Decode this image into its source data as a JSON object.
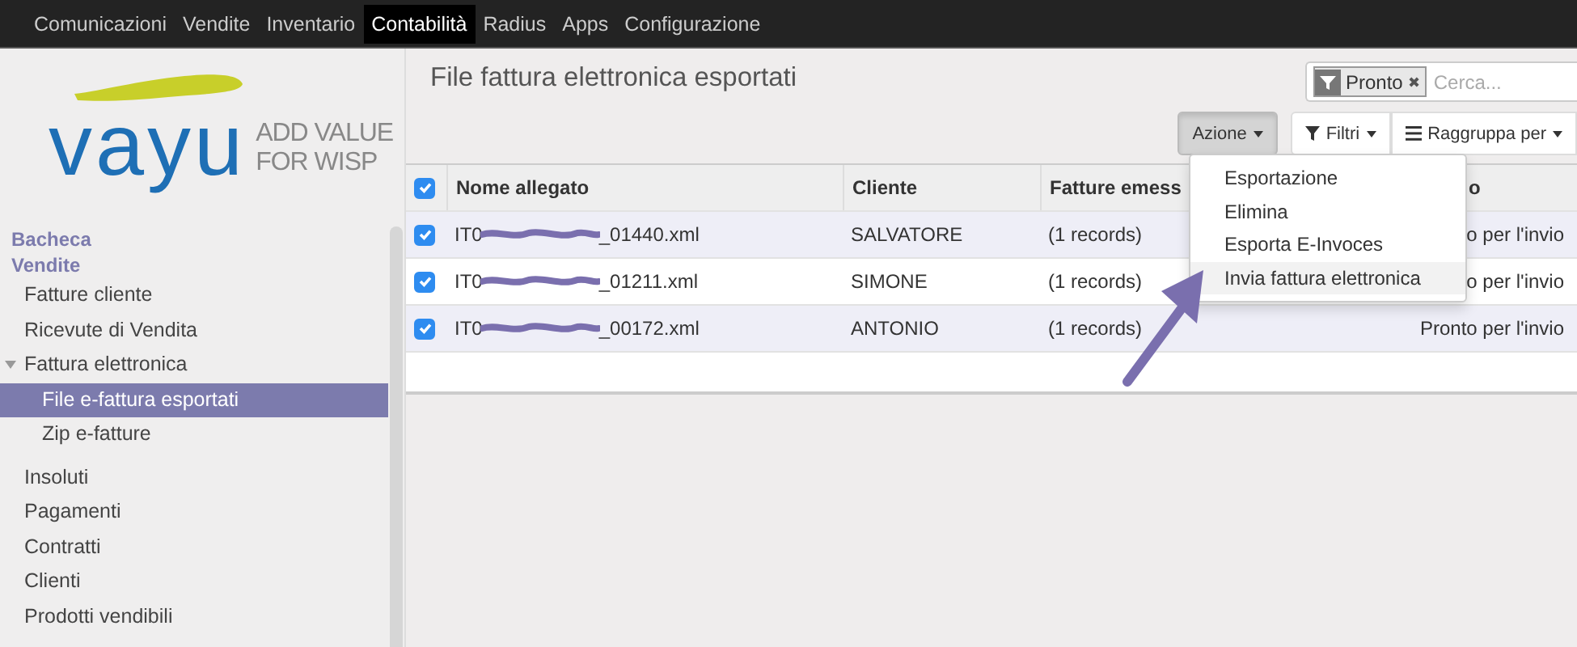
{
  "top_menu": [
    {
      "label": "Comunicazioni",
      "selected": false
    },
    {
      "label": "Vendite",
      "selected": false
    },
    {
      "label": "Inventario",
      "selected": false
    },
    {
      "label": "Contabilità",
      "selected": true
    },
    {
      "label": "Radius",
      "selected": false
    },
    {
      "label": "Apps",
      "selected": false
    },
    {
      "label": "Configurazione",
      "selected": false
    }
  ],
  "logo": {
    "wordmark": "vayu",
    "tagline_1": "ADD VALUE",
    "tagline_2": "FOR WISP"
  },
  "sidebar": {
    "items": [
      {
        "kind": "heading",
        "label": "Bacheca"
      },
      {
        "kind": "heading",
        "label": "Vendite"
      },
      {
        "kind": "item",
        "label": "Fatture cliente",
        "selected": false
      },
      {
        "kind": "item",
        "label": "Ricevute di Vendita",
        "selected": false
      },
      {
        "kind": "group",
        "label": "Fattura elettronica",
        "expanded": true,
        "children": [
          {
            "label": "File e-fattura esportati",
            "selected": true
          },
          {
            "label": "Zip e-fatture",
            "selected": false
          }
        ]
      },
      {
        "kind": "item",
        "label": "Insoluti",
        "selected": false
      },
      {
        "kind": "item",
        "label": "Pagamenti",
        "selected": false
      },
      {
        "kind": "item",
        "label": "Contratti",
        "selected": false
      },
      {
        "kind": "item",
        "label": "Clienti",
        "selected": false
      },
      {
        "kind": "item",
        "label": "Prodotti vendibili",
        "selected": false
      }
    ]
  },
  "page_title": "File fattura elettronica esportati",
  "search": {
    "facet": "Pronto",
    "facet_remove": "✖",
    "placeholder": "Cerca..."
  },
  "buttons": [
    {
      "kind": "action",
      "label": "Azione",
      "expanded": true
    },
    {
      "kind": "filter",
      "label": "Filtri",
      "expanded": false
    },
    {
      "kind": "group",
      "label": "Raggruppa per",
      "expanded": false
    }
  ],
  "action_menu": [
    {
      "label": "Esportazione",
      "selected": false
    },
    {
      "label": "Elimina",
      "selected": false
    },
    {
      "label": "Esporta E-Invoces",
      "selected": false
    },
    {
      "label": "Invia fattura elettronica",
      "selected": true
    }
  ],
  "table": {
    "all_checked": true,
    "columns": [
      "Nome allegato",
      "Cliente",
      "Fatture emess",
      "o"
    ],
    "rows": [
      {
        "checked": true,
        "name_start": "IT0",
        "name_end": "_01440.xml",
        "cliente": "SALVATORE",
        "fatture": "(1 records)",
        "stato": "o per l'invio"
      },
      {
        "checked": true,
        "name_start": "IT0",
        "name_end": "_01211.xml",
        "cliente": "SIMONE",
        "fatture": "(1 records)",
        "stato": "o per l'invio"
      },
      {
        "checked": true,
        "name_start": "IT0",
        "name_end": "_00172.xml",
        "cliente": "ANTONIO",
        "fatture": "(1 records)",
        "stato": "Pronto per l'invio"
      }
    ]
  }
}
